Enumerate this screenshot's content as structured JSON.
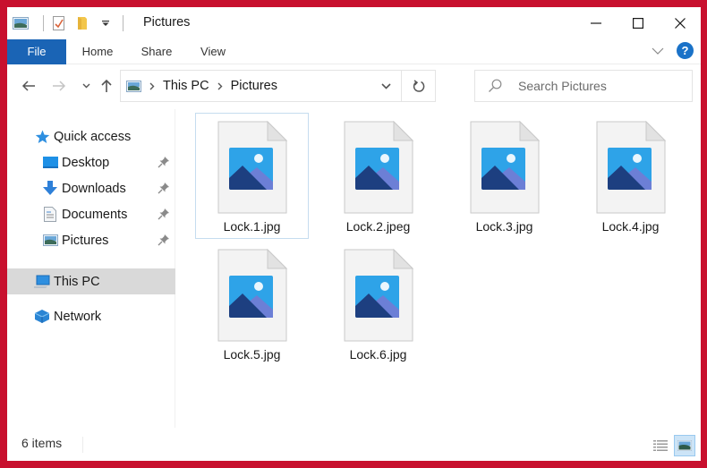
{
  "window": {
    "title": "Pictures",
    "controls": {
      "minimize": "minimize",
      "maximize": "maximize",
      "close": "close"
    }
  },
  "quick_access_toolbar": {
    "icons": [
      "pictures-app-icon",
      "properties-icon",
      "new-folder-icon",
      "customize-dropdown-icon"
    ]
  },
  "ribbon": {
    "tabs": [
      {
        "label": "File",
        "active": true
      },
      {
        "label": "Home"
      },
      {
        "label": "Share"
      },
      {
        "label": "View"
      }
    ],
    "help_label": "?"
  },
  "navigation": {
    "breadcrumb": [
      "This PC",
      "Pictures"
    ],
    "search_placeholder": "Search Pictures"
  },
  "sidebar": {
    "items": [
      {
        "label": "Quick access",
        "icon": "star-icon"
      },
      {
        "label": "Desktop",
        "icon": "desktop-icon",
        "pinned": true
      },
      {
        "label": "Downloads",
        "icon": "downloads-icon",
        "pinned": true
      },
      {
        "label": "Documents",
        "icon": "documents-icon",
        "pinned": true
      },
      {
        "label": "Pictures",
        "icon": "pictures-icon",
        "pinned": true
      },
      {
        "label": "This PC",
        "icon": "this-pc-icon",
        "selected": true
      },
      {
        "label": "Network",
        "icon": "network-icon"
      }
    ]
  },
  "files": [
    {
      "name": "Lock.1.jpg"
    },
    {
      "name": "Lock.2.jpeg"
    },
    {
      "name": "Lock.3.jpg"
    },
    {
      "name": "Lock.4.jpg"
    },
    {
      "name": "Lock.5.jpg"
    },
    {
      "name": "Lock.6.jpg"
    }
  ],
  "status": {
    "item_count": "6 items",
    "view_modes": [
      "details-view",
      "large-icons-view"
    ],
    "active_view": "large-icons-view"
  },
  "colors": {
    "accent": "#1a64b5",
    "background": "#c8102e",
    "selected_nav": "#d9d9d9"
  }
}
